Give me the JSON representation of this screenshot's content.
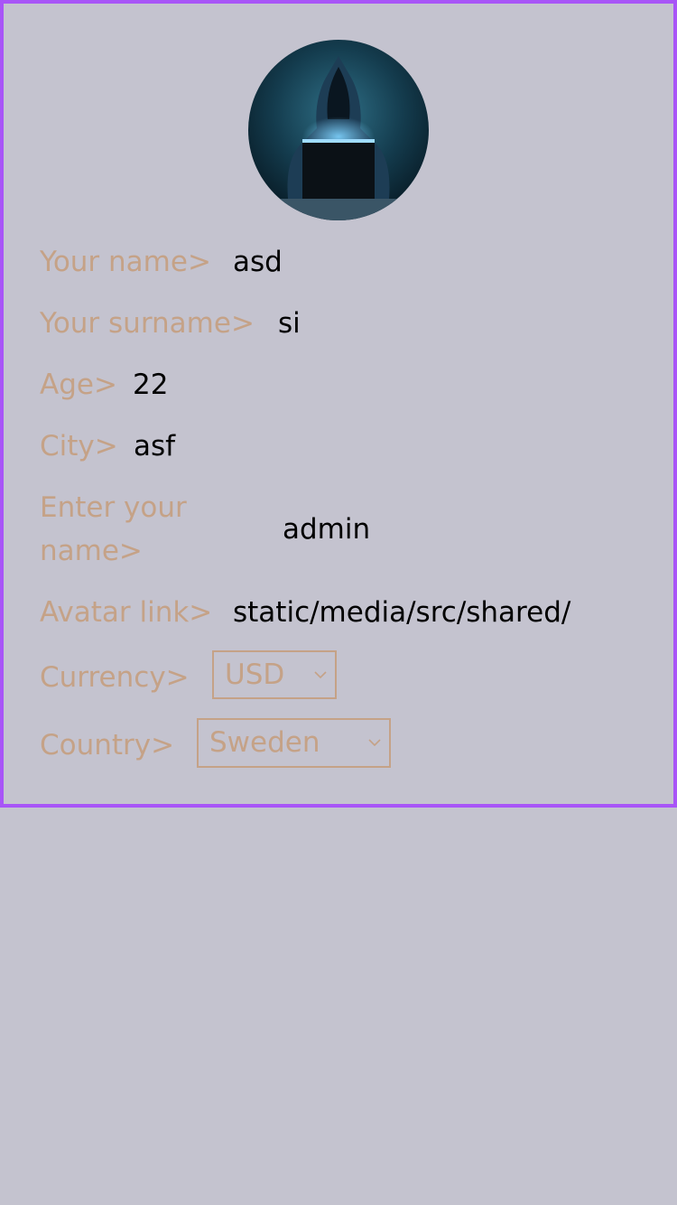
{
  "profile": {
    "avatar_icon": "hooded-hacker-avatar",
    "fields": {
      "name": {
        "label": "Your name>",
        "value": "asd"
      },
      "surname": {
        "label": "Your surname>",
        "value": "si"
      },
      "age": {
        "label": "Age>",
        "value": "22"
      },
      "city": {
        "label": "City>",
        "value": "asf"
      },
      "username": {
        "label_line1": "Enter your",
        "label_line2": "name>",
        "value": "admin"
      },
      "avatar_link": {
        "label": "Avatar link>",
        "value": "static/media/src/shared/"
      },
      "currency": {
        "label": "Currency>",
        "selected": "USD"
      },
      "country": {
        "label": "Country>",
        "selected": "Sweden"
      }
    }
  },
  "colors": {
    "background": "#c4c3cf",
    "border": "#a855f7",
    "label": "#c5a287",
    "value": "#000000"
  }
}
